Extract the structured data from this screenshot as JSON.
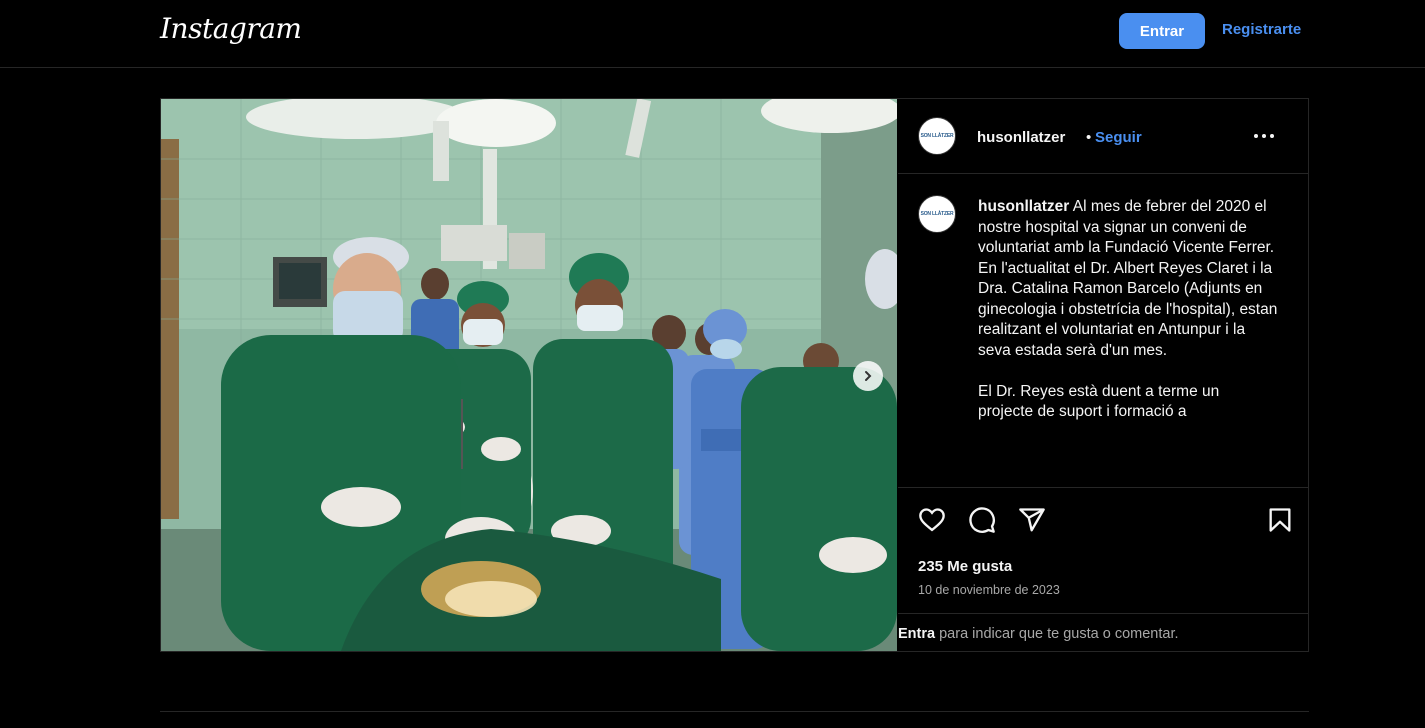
{
  "nav": {
    "logo": "Instagram",
    "login_label": "Entrar",
    "register_label": "Registrarte"
  },
  "post": {
    "username": "husonllatzer",
    "separator": "•",
    "follow_label": "Seguir",
    "avatar_text": "SON LLÀTZER",
    "caption_user": "husonllatzer",
    "caption_text": " Al mes de febrer del 2020 el nostre hospital va signar un conveni de voluntariat amb la Fundació Vicente Ferrer. En l'actualitat el Dr. Albert Reyes Claret i la Dra. Catalina Ramon Barcelo (Adjunts en ginecologia i obstetrícia de l'hospital), estan realitzant el voluntariat en Antunpur i la seva estada serà d'un mes.\n\nEl Dr. Reyes està duent a terme un projecte de suport i formació a",
    "likes": "235 Me gusta",
    "date": "10 de noviembre de 2023",
    "login_prompt_link": "Entra",
    "login_prompt_text": " para indicar que te gusta o comentar."
  },
  "icons": {
    "like": "heart-icon",
    "comment": "comment-icon",
    "share": "send-icon",
    "save": "bookmark-icon",
    "more": "more-options-icon",
    "next": "chevron-right-icon"
  },
  "colors": {
    "accent": "#4a8ff0",
    "background": "#000000",
    "border": "#262626",
    "muted_text": "#a8a8a8"
  }
}
